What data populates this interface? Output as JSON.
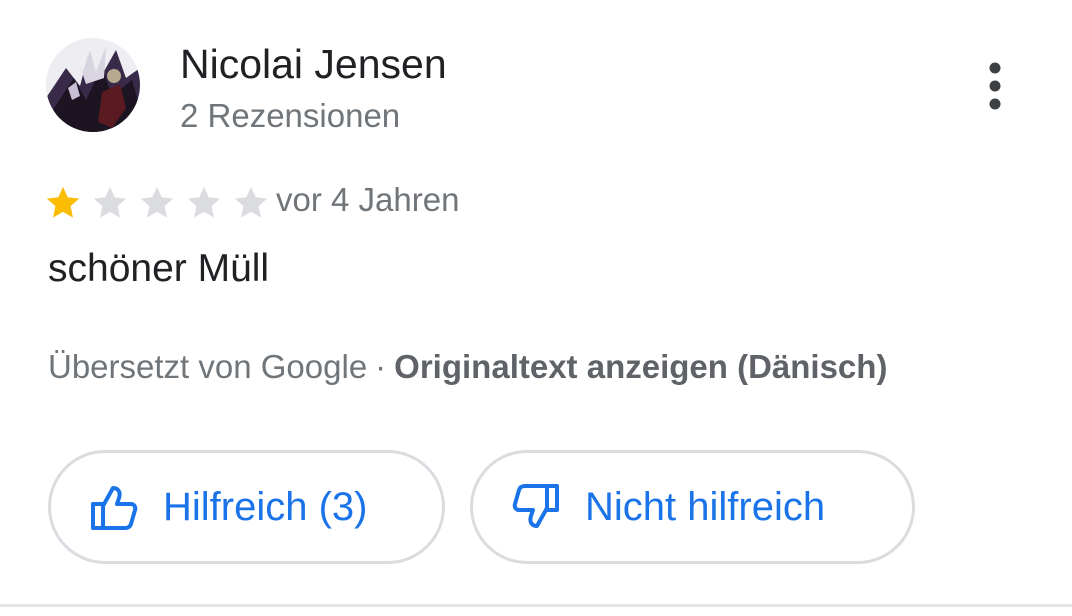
{
  "review": {
    "author": {
      "name": "Nicolai Jensen",
      "review_count_text": "2 Rezensionen"
    },
    "rating": 1,
    "rating_max": 5,
    "date": "vor 4 Jahren",
    "text": "schöner Müll",
    "translation": {
      "translated_by": "Übersetzt von Google",
      "separator": "·",
      "show_original_label": "Originaltext anzeigen (Dänisch)"
    }
  },
  "actions": {
    "helpful_label": "Hilfreich (3)",
    "not_helpful_label": "Nicht hilfreich"
  },
  "icons": {
    "more": "more-vert-icon",
    "thumb_up": "thumb-up-icon",
    "thumb_down": "thumb-down-icon",
    "star": "star-icon"
  },
  "colors": {
    "star_filled": "#fbbc04",
    "star_empty": "#dadce0",
    "accent": "#1a73e8",
    "text_primary": "#202124",
    "text_secondary": "#70757a",
    "outline": "#dadce0"
  }
}
